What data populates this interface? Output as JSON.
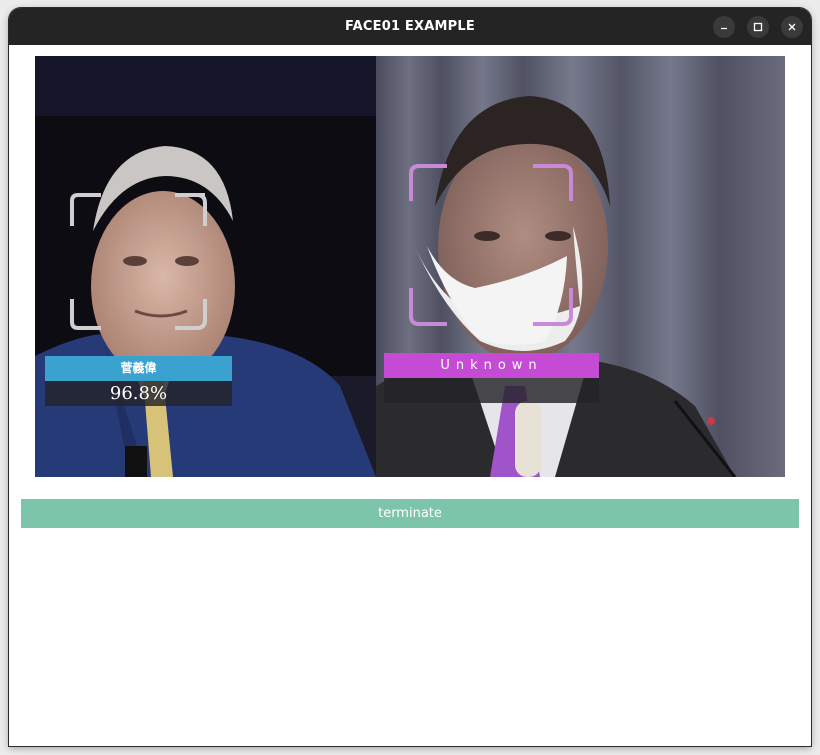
{
  "window": {
    "title": "FACE01 EXAMPLE",
    "controls": {
      "minimize_icon": "minimize-icon",
      "maximize_icon": "maximize-icon",
      "close_icon": "close-icon"
    }
  },
  "video": {
    "faces": [
      {
        "name": "菅義偉",
        "score": "96.8%",
        "box_color": "#cfcfcf",
        "label_color": "#3aa2cf"
      },
      {
        "name": "Unknown",
        "score": "",
        "box_color": "#c88ad6",
        "label_color": "#c64bd4"
      }
    ]
  },
  "actions": {
    "terminate_label": "terminate",
    "terminate_color": "#7cc5aa"
  }
}
